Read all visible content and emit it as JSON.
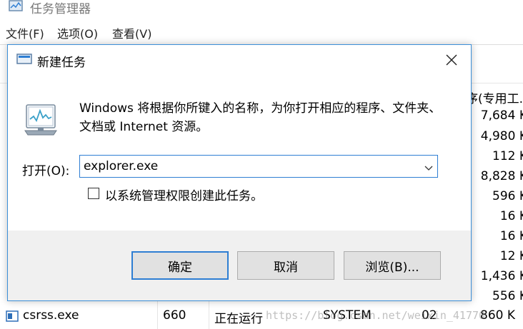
{
  "task_manager": {
    "title": "任务管理器",
    "menu": [
      "文件(F)",
      "选项(O)",
      "查看(V)"
    ],
    "memory_column_header": "序(专用工.",
    "memory_values": [
      "7,684 K",
      "4,980 K",
      "112 K",
      "8,828 K",
      "596 K",
      "16 K",
      "16 K",
      "12 K",
      "1,436 K",
      "556 K"
    ],
    "last_row": {
      "name": "csrss.exe",
      "pid": "660",
      "status": "正在运行",
      "user": "SYSTEM",
      "cpu": "02",
      "memory": "860 K"
    }
  },
  "watermark": "https://blog.csdn.net/weixin_41770",
  "dialog": {
    "title": "新建任务",
    "description": "Windows 将根据你所键入的名称，为你打开相应的程序、文件夹、文档或 Internet 资源。",
    "open_label": "打开(O):",
    "open_value": "explorer.exe",
    "admin_checkbox_label": "以系统管理权限创建此任务。",
    "admin_checked": false,
    "buttons": {
      "ok": "确定",
      "cancel": "取消",
      "browse": "浏览(B)..."
    }
  },
  "colors": {
    "accent": "#2e7ed3",
    "footer_bg": "#f0f0f0"
  }
}
